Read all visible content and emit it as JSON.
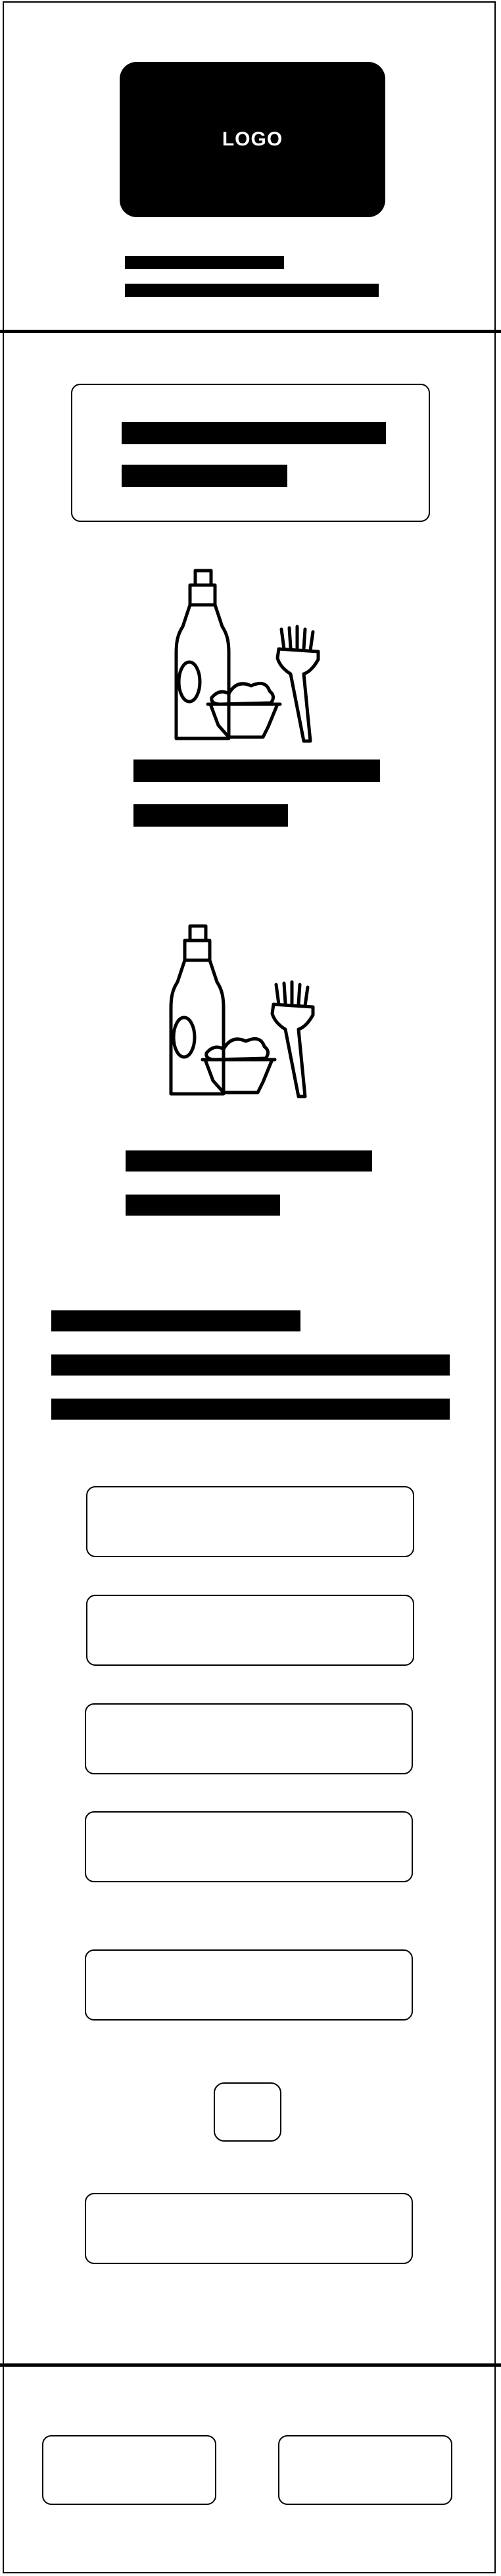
{
  "header": {
    "logo_text": "LOGO"
  },
  "icons": {
    "product_icon_1": "hair-color-kit-icon",
    "product_icon_2": "hair-color-kit-icon"
  }
}
